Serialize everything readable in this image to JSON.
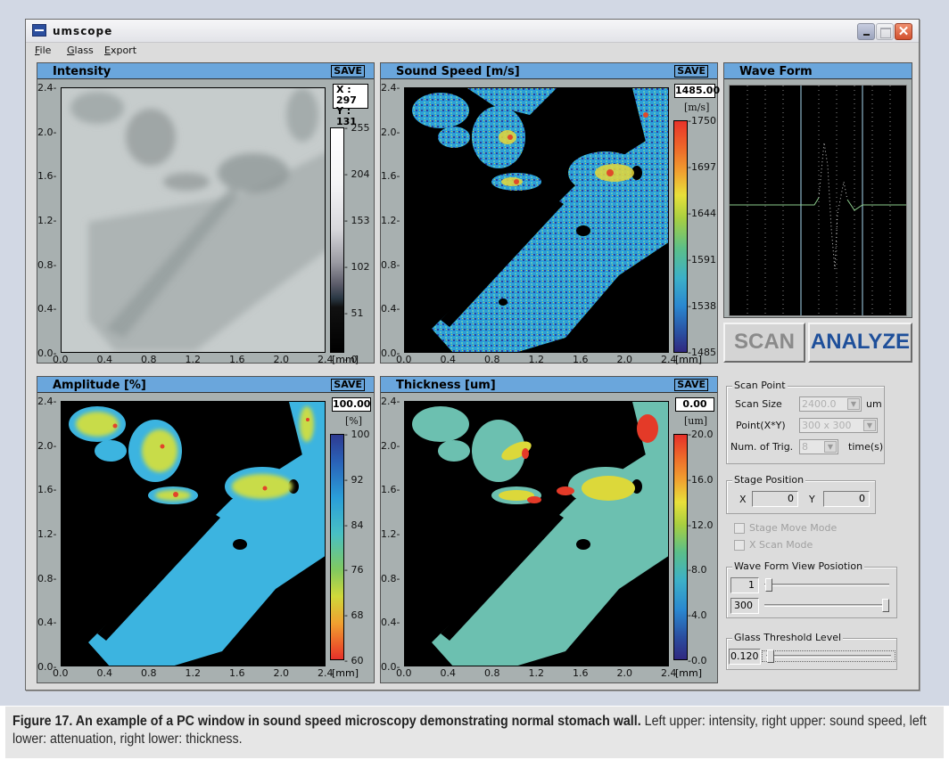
{
  "window": {
    "title": "umscope",
    "controls": {
      "minimize": "minimize",
      "maximize": "maximize",
      "close": "✕"
    }
  },
  "menu": [
    {
      "label": "File",
      "accel": "F",
      "rest": "ile"
    },
    {
      "label": "Glass",
      "accel": "G",
      "rest": "lass"
    },
    {
      "label": "Export",
      "accel": "E",
      "rest": "xport"
    }
  ],
  "axes": {
    "y_ticks": [
      "2.4",
      "2.0",
      "1.6",
      "1.2",
      "0.8",
      "0.4",
      "0.0"
    ],
    "x_ticks": [
      "0.0",
      "0.4",
      "0.8",
      "1.2",
      "1.6",
      "2.0",
      "2.4"
    ],
    "x_unit": "[mm]",
    "range_mm": [
      0.0,
      2.4
    ]
  },
  "panels": {
    "intensity": {
      "title": "Intensity",
      "save": "SAVE",
      "readout_x": "X : 297",
      "readout_y": "Y : 131",
      "colorbar_ticks": [
        "255",
        "204",
        "153",
        "102",
        "51",
        "0"
      ],
      "colorbar_range": [
        0,
        255
      ]
    },
    "sound_speed": {
      "title": "Sound Speed [m/s]",
      "save": "SAVE",
      "value": "1485.00",
      "unit": "[m/s]",
      "colorbar_ticks": [
        "1750",
        "1697",
        "1644",
        "1591",
        "1538",
        "1485"
      ],
      "colorbar_range": [
        1485,
        1750
      ]
    },
    "amplitude": {
      "title": "Amplitude [%]",
      "save": "SAVE",
      "value": "100.00",
      "unit": "[%]",
      "colorbar_ticks": [
        "100",
        "92",
        "84",
        "76",
        "68",
        "60"
      ],
      "colorbar_range": [
        60,
        100
      ]
    },
    "thickness": {
      "title": "Thickness [um]",
      "save": "SAVE",
      "value": "0.00",
      "unit": "[um]",
      "colorbar_ticks": [
        "20.0",
        "16.0",
        "12.0",
        "8.0",
        "4.0",
        "0.0"
      ],
      "colorbar_range": [
        0.0,
        20.0
      ]
    }
  },
  "waveform": {
    "title": "Wave Form"
  },
  "buttons": {
    "scan": "SCAN",
    "analyze": "ANALYZE"
  },
  "scan_point": {
    "group_label": "Scan Point",
    "scan_size_label": "Scan Size",
    "scan_size_value": "2400.0",
    "scan_size_unit": "um",
    "points_label": "Point(X*Y)",
    "points_value": "300 x 300",
    "trig_label": "Num. of Trig.",
    "trig_value": "8",
    "trig_unit": "time(s)"
  },
  "stage_position": {
    "group_label": "Stage Position",
    "x_label": "X",
    "x_value": "0",
    "y_label": "Y",
    "y_value": "0"
  },
  "checkboxes": {
    "stage_move_mode": "Stage Move Mode",
    "x_scan_mode": "X Scan Mode"
  },
  "wave_form_view": {
    "group_label": "Wave Form View Posiotion",
    "start_value": "1",
    "end_value": "300",
    "range": [
      1,
      300
    ]
  },
  "glass_threshold": {
    "group_label": "Glass Threshold Level",
    "value": "0.120"
  },
  "caption": {
    "bold": "Figure 17. An example of a PC window in sound speed microscopy demonstrating normal stomach wall.",
    "text": " Left upper: intensity, right upper: sound speed, left lower: attenuation, right lower: thickness."
  },
  "colors": {
    "panel_header": "#6aa6dc",
    "analyze_text": "#1e4f9a",
    "close_button": "#d2502e"
  }
}
